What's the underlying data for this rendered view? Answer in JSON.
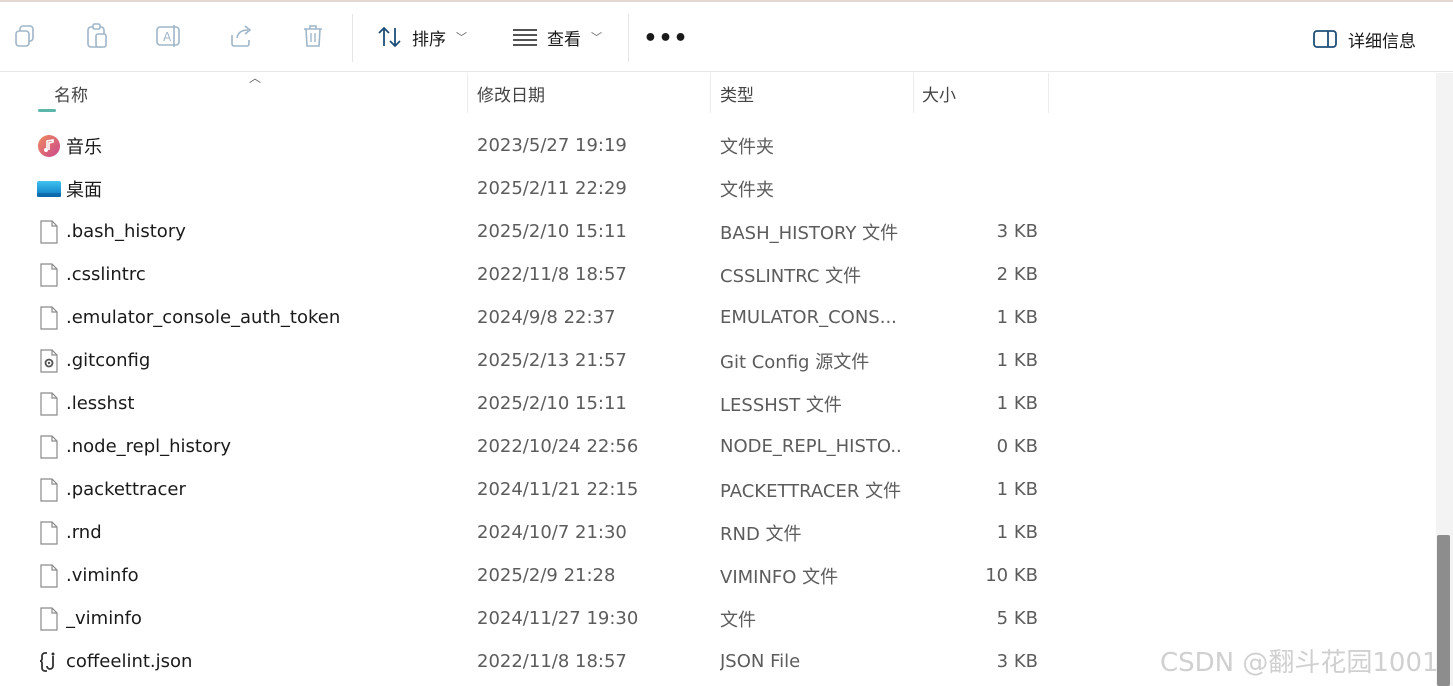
{
  "toolbar": {
    "sort_label": "排序",
    "view_label": "查看",
    "more_label": "•••",
    "details_label": "详细信息"
  },
  "columns": {
    "name": "名称",
    "date": "修改日期",
    "type": "类型",
    "size": "大小"
  },
  "files": [
    {
      "name": "音乐",
      "date": "2023/5/27 19:19",
      "type": "文件夹",
      "size": "",
      "icon": "music-folder-icon"
    },
    {
      "name": "桌面",
      "date": "2025/2/11 22:29",
      "type": "文件夹",
      "size": "",
      "icon": "desktop-folder-icon"
    },
    {
      "name": ".bash_history",
      "date": "2025/2/10 15:11",
      "type": "BASH_HISTORY 文件",
      "size": "3 KB",
      "icon": "file-icon"
    },
    {
      "name": ".csslintrc",
      "date": "2022/11/8 18:57",
      "type": "CSSLINTRC 文件",
      "size": "2 KB",
      "icon": "file-icon"
    },
    {
      "name": ".emulator_console_auth_token",
      "date": "2024/9/8 22:37",
      "type": "EMULATOR_CONS...",
      "size": "1 KB",
      "icon": "file-icon"
    },
    {
      "name": ".gitconfig",
      "date": "2025/2/13 21:57",
      "type": "Git Config 源文件",
      "size": "1 KB",
      "icon": "config-file-icon"
    },
    {
      "name": ".lesshst",
      "date": "2025/2/10 15:11",
      "type": "LESSHST 文件",
      "size": "1 KB",
      "icon": "file-icon"
    },
    {
      "name": ".node_repl_history",
      "date": "2022/10/24 22:56",
      "type": "NODE_REPL_HISTO...",
      "size": "0 KB",
      "icon": "file-icon"
    },
    {
      "name": ".packettracer",
      "date": "2024/11/21 22:15",
      "type": "PACKETTRACER 文件",
      "size": "1 KB",
      "icon": "file-icon"
    },
    {
      "name": ".rnd",
      "date": "2024/10/7 21:30",
      "type": "RND 文件",
      "size": "1 KB",
      "icon": "file-icon"
    },
    {
      "name": ".viminfo",
      "date": "2025/2/9 21:28",
      "type": "VIMINFO 文件",
      "size": "10 KB",
      "icon": "file-icon"
    },
    {
      "name": "_viminfo",
      "date": "2024/11/27 19:30",
      "type": "文件",
      "size": "5 KB",
      "icon": "file-icon"
    },
    {
      "name": "coffeelint.json",
      "date": "2022/11/8 18:57",
      "type": "JSON File",
      "size": "3 KB",
      "icon": "json-file-icon"
    }
  ],
  "watermark": "CSDN @翻斗花园1001"
}
